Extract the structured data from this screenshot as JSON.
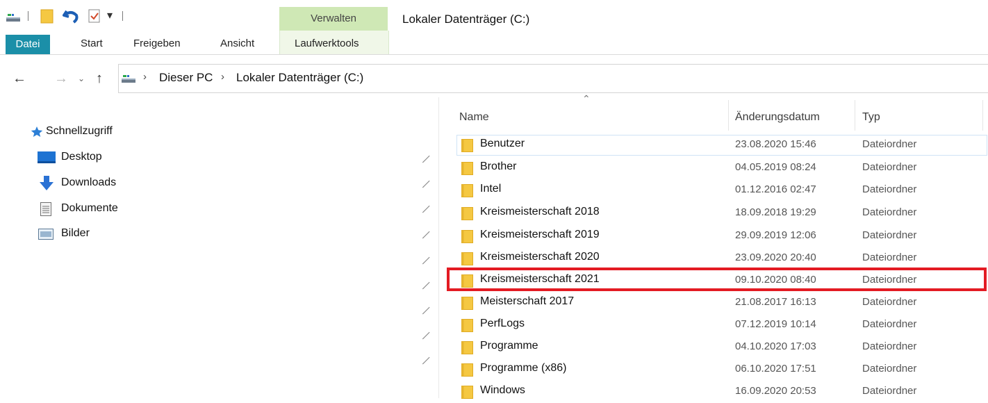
{
  "window": {
    "title": "Lokaler Datenträger (C:)",
    "contextual_group": "Verwalten",
    "contextual_tab": "Laufwerktools"
  },
  "ribbon": {
    "tabs": [
      "Datei",
      "Start",
      "Freigeben",
      "Ansicht"
    ]
  },
  "address": {
    "crumbs": [
      "Dieser PC",
      "Lokaler Datenträger (C:)"
    ]
  },
  "nav_pane": {
    "quick_access": "Schnellzugriff",
    "items": [
      {
        "label": "Desktop",
        "icon": "desktop-icon"
      },
      {
        "label": "Downloads",
        "icon": "download-arrow-icon"
      },
      {
        "label": "Dokumente",
        "icon": "document-icon"
      },
      {
        "label": "Bilder",
        "icon": "pictures-icon"
      }
    ]
  },
  "columns": {
    "name": "Name",
    "date": "Änderungsdatum",
    "type": "Typ"
  },
  "files": [
    {
      "name": "Benutzer",
      "date": "23.08.2020 15:46",
      "type": "Dateiordner"
    },
    {
      "name": "Brother",
      "date": "04.05.2019 08:24",
      "type": "Dateiordner"
    },
    {
      "name": "Intel",
      "date": "01.12.2016 02:47",
      "type": "Dateiordner"
    },
    {
      "name": "Kreismeisterschaft 2018",
      "date": "18.09.2018 19:29",
      "type": "Dateiordner"
    },
    {
      "name": "Kreismeisterschaft 2019",
      "date": "29.09.2019 12:06",
      "type": "Dateiordner"
    },
    {
      "name": "Kreismeisterschaft 2020",
      "date": "23.09.2020 20:40",
      "type": "Dateiordner"
    },
    {
      "name": "Kreismeisterschaft 2021",
      "date": "09.10.2020 08:40",
      "type": "Dateiordner"
    },
    {
      "name": "Meisterschaft 2017",
      "date": "21.08.2017 16:13",
      "type": "Dateiordner"
    },
    {
      "name": "PerfLogs",
      "date": "07.12.2019 10:14",
      "type": "Dateiordner"
    },
    {
      "name": "Programme",
      "date": "04.10.2020 17:03",
      "type": "Dateiordner"
    },
    {
      "name": "Programme (x86)",
      "date": "06.10.2020 17:51",
      "type": "Dateiordner"
    },
    {
      "name": "Windows",
      "date": "16.09.2020 20:53",
      "type": "Dateiordner"
    }
  ],
  "highlighted_file": "Kreismeisterschaft 2021",
  "colors": {
    "file_tab": "#1b8fa8",
    "contextual": "#cfe8b5",
    "highlight": "#e31b23",
    "folder": "#f5c842"
  }
}
